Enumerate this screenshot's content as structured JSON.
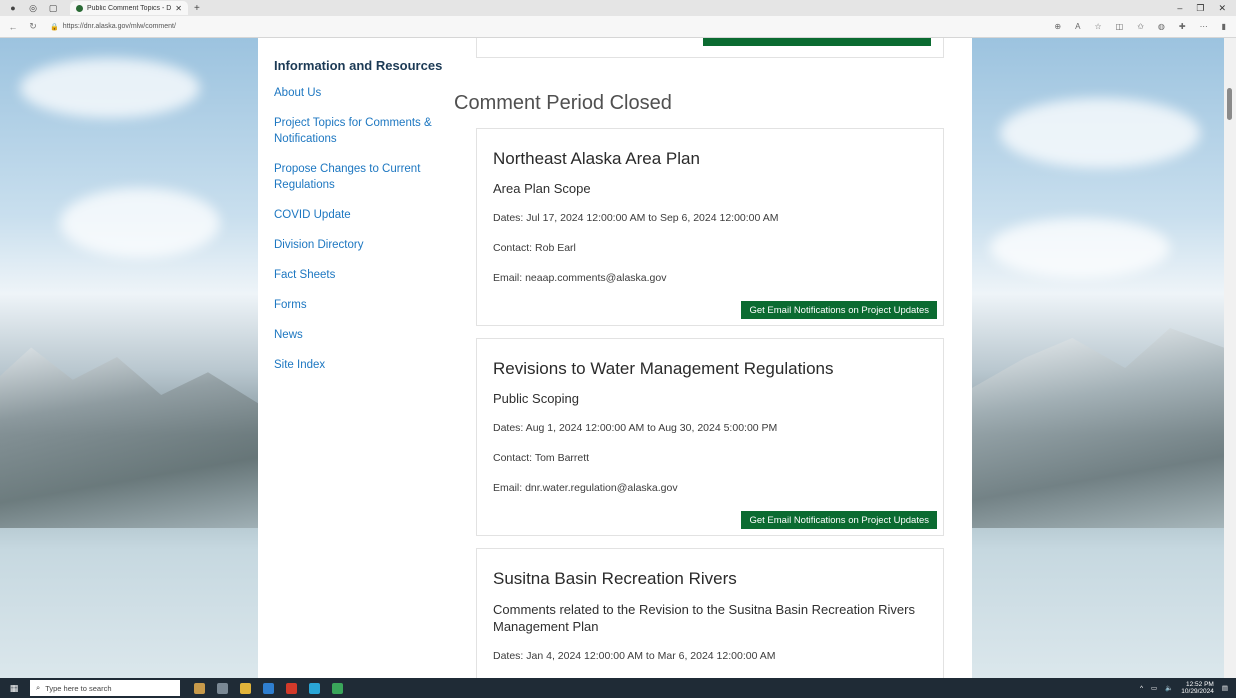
{
  "browser": {
    "tab_title": "Public Comment Topics - Divisio",
    "url": "https://dnr.alaska.gov/mlw/comment/"
  },
  "sidebar": {
    "heading": "Information and Resources",
    "links": [
      "About Us",
      "Project Topics for Comments & Notifications",
      "Propose Changes to Current Regulations",
      "COVID Update",
      "Division Directory",
      "Fact Sheets",
      "Forms",
      "News",
      "Site Index"
    ]
  },
  "main": {
    "section_title": "Comment Period Closed",
    "cards": [
      {
        "title": "Northeast Alaska Area Plan",
        "subtitle": "Area Plan Scope",
        "dates": "Dates: Jul 17, 2024 12:00:00 AM to Sep 6, 2024 12:00:00 AM",
        "contact": "Contact: Rob Earl",
        "email": "Email: neaap.comments@alaska.gov",
        "button": "Get Email Notifications on Project Updates"
      },
      {
        "title": "Revisions to Water Management Regulations",
        "subtitle": "Public Scoping",
        "dates": "Dates: Aug 1, 2024 12:00:00 AM to Aug 30, 2024 5:00:00 PM",
        "contact": "Contact: Tom Barrett",
        "email": "Email: dnr.water.regulation@alaska.gov",
        "button": "Get Email Notifications on Project Updates"
      },
      {
        "title": "Susitna Basin Recreation Rivers",
        "subtitle": "Comments related to the Revision to the Susitna Basin Recreation Rivers Management Plan",
        "dates": "Dates: Jan 4, 2024 12:00:00 AM to Mar 6, 2024 12:00:00 AM"
      }
    ]
  },
  "taskbar": {
    "search_placeholder": "Type here to search",
    "time": "12:52 PM",
    "date": "10/29/2024"
  },
  "colors": {
    "link": "#1d77c1",
    "button_green": "#0b6b31",
    "heading_navy": "#1c3a55"
  }
}
